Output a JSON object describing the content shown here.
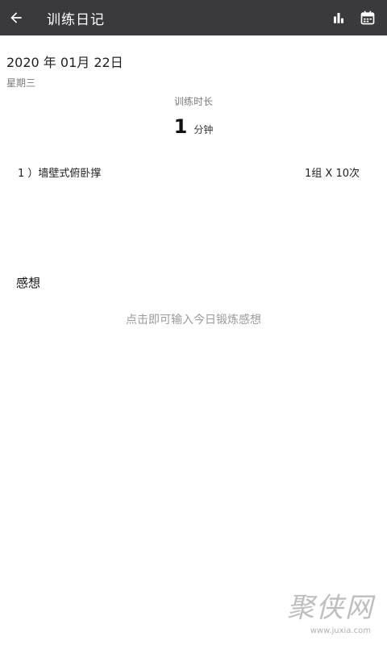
{
  "appbar": {
    "title": "训练日记",
    "back_icon": "arrow-back-icon",
    "actions": [
      {
        "icon": "bar-chart-icon"
      },
      {
        "icon": "calendar-icon"
      }
    ],
    "background": "#3a3a3d"
  },
  "diary": {
    "date": "2020 年 01月 22日",
    "weekday": "星期三",
    "duration_label": "训练时长",
    "duration_value": "1",
    "duration_unit": "分钟"
  },
  "exercises": [
    {
      "name": "1 ）墙壁式俯卧撑",
      "sets": "1组 X 10次"
    }
  ],
  "thoughts": {
    "title": "感想",
    "placeholder": "点击即可输入今日锻炼感想"
  },
  "watermark": {
    "text": "聚侠网",
    "url": "www.juxia.com"
  }
}
